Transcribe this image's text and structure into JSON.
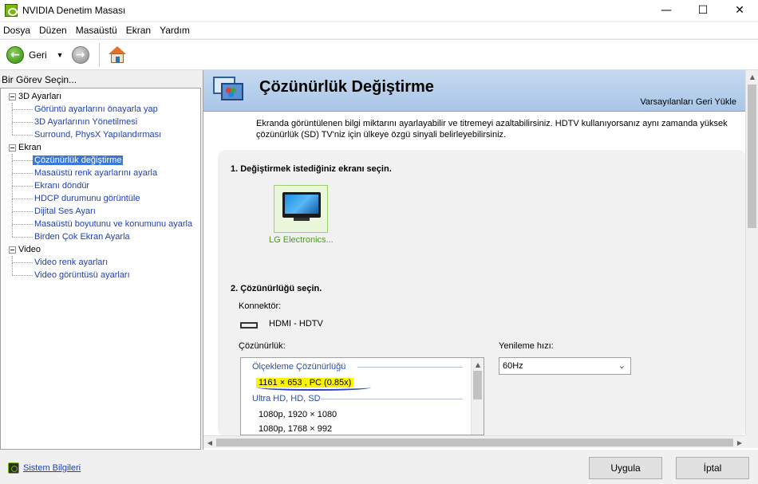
{
  "window": {
    "title": "NVIDIA Denetim Masası",
    "minimize_glyph": "—",
    "maximize_glyph": "☐",
    "close_glyph": "✕"
  },
  "menu": {
    "items": [
      "Dosya",
      "Düzen",
      "Masaüstü",
      "Ekran",
      "Yardım"
    ]
  },
  "toolbar": {
    "back_label": "Geri",
    "back_glyph": "←",
    "forward_glyph": "→",
    "caret_glyph": "▼"
  },
  "left": {
    "header": "Bir Görev Seçin...",
    "categories": [
      {
        "label": "3D Ayarları",
        "items": [
          "Görüntü ayarlarını önayarla yap",
          "3D Ayarlarının Yönetilmesi",
          "Surround, PhysX Yapılandırması"
        ]
      },
      {
        "label": "Ekran",
        "items": [
          "Çözünürlük değiştirme",
          "Masaüstü renk ayarlarını ayarla",
          "Ekranı döndür",
          "HDCP durumunu görüntüle",
          "Dijital Ses Ayarı",
          "Masaüstü boyutunu ve konumunu ayarla",
          "Birden Çok Ekran Ayarla"
        ]
      },
      {
        "label": "Video",
        "items": [
          "Video renk ayarları",
          "Video görüntüsü ayarları"
        ]
      }
    ],
    "selected_item": "Çözünürlük değiştirme"
  },
  "main": {
    "title": "Çözünürlük Değiştirme",
    "restore_defaults": "Varsayılanları Geri Yükle",
    "description": "Ekranda görüntülenen bilgi miktarını ayarlayabilir ve titremeyi azaltabilirsiniz. HDTV kullanıyorsanız aynı zamanda yüksek çözünürlük (SD) TV'niz için ülkeye özgü sinyali belirleyebilirsiniz.",
    "step1": "1. Değiştirmek istediğiniz ekranı seçin.",
    "display_name": "LG Electronics...",
    "step2": "2. Çözünürlüğü seçin.",
    "connector_label": "Konnektör:",
    "connector_value": "HDMI - HDTV",
    "resolution_label": "Çözünürlük:",
    "refresh_label": "Yenileme hızı:",
    "refresh_value": "60Hz",
    "resolution_list": {
      "group1": "Ölçekleme Çözünürlüğü",
      "group1_rows": [
        "1161 × 653 , PC (0.85x)"
      ],
      "group2": "Ultra HD, HD, SD",
      "group2_rows": [
        "1080p, 1920 × 1080",
        "1080p, 1768 × 992"
      ]
    }
  },
  "footer": {
    "system_info": "Sistem Bilgileri",
    "apply": "Uygula",
    "cancel": "İptal"
  },
  "colors": {
    "accent_green": "#76b900",
    "selection_blue": "#3a78d8",
    "highlight_yellow": "#fff400",
    "banner_blue": "#a9c6e8"
  },
  "icons": {
    "back": "arrow-left-circle-icon",
    "forward": "arrow-right-circle-icon",
    "home": "home-icon",
    "display": "tv-monitor-icon",
    "connector": "hdmi-connector-icon"
  }
}
